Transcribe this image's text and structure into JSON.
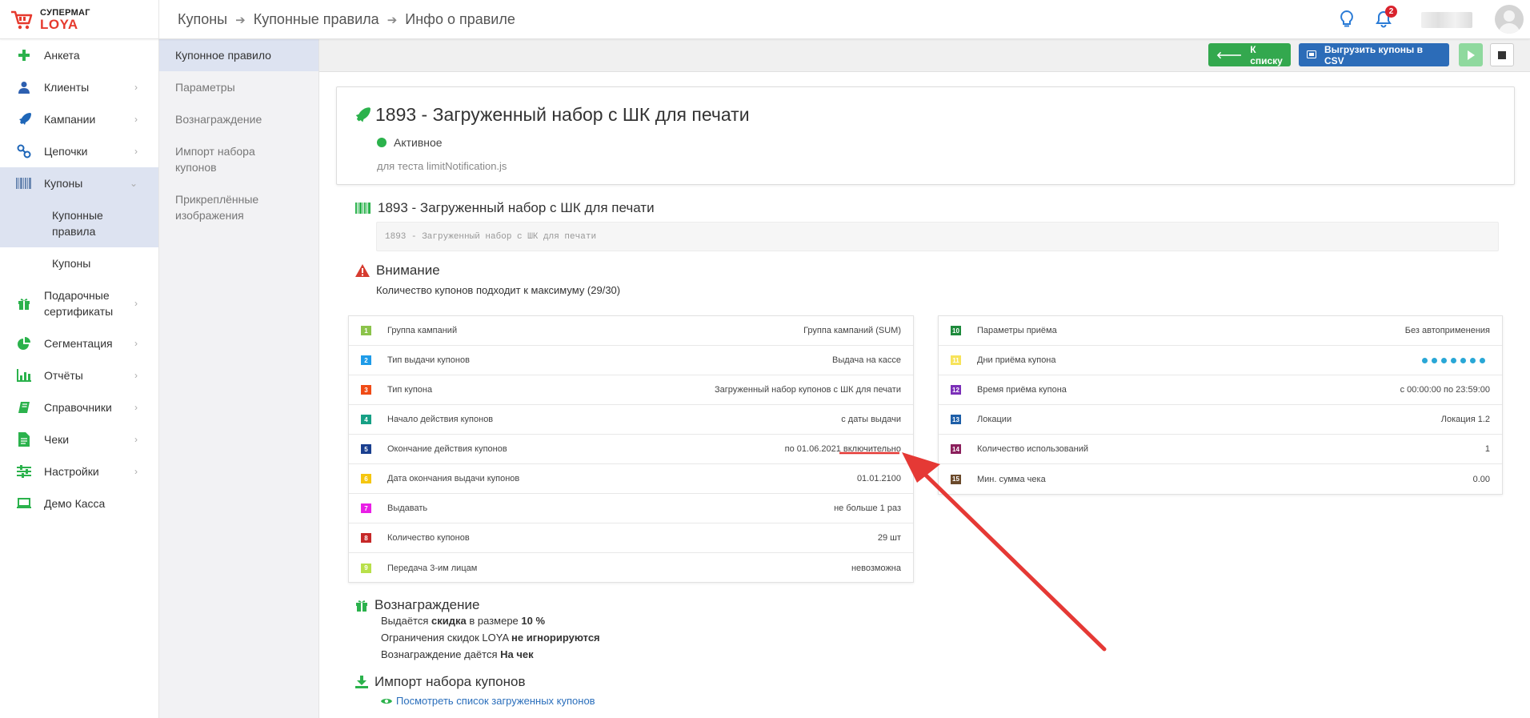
{
  "header": {
    "logo_top": "СУПЕРМАГ",
    "logo_bottom": "LOYA",
    "breadcrumb": [
      "Купоны",
      "Купонные правила",
      "Инфо о правиле"
    ],
    "notifications_count": "2",
    "icons": [
      "lightbulb-icon",
      "bell-icon",
      "user-avatar"
    ]
  },
  "sidebar": {
    "items": [
      {
        "label": "Анкета",
        "icon": "plus-icon",
        "color": "#2bb24c"
      },
      {
        "label": "Клиенты",
        "icon": "user-icon",
        "color": "#2c5fb0"
      },
      {
        "label": "Кампании",
        "icon": "rocket-icon",
        "color": "#1e66b8"
      },
      {
        "label": "Цепочки",
        "icon": "chain-icon",
        "color": "#1e66b8"
      },
      {
        "label": "Купоны",
        "icon": "barcode-icon",
        "color": "#6d8ab3"
      },
      {
        "label": "Подарочные сертификаты",
        "icon": "gift-icon",
        "color": "#2bb24c"
      },
      {
        "label": "Сегментация",
        "icon": "pie-icon",
        "color": "#2bb24c"
      },
      {
        "label": "Отчёты",
        "icon": "bar-chart-icon",
        "color": "#2bb24c"
      },
      {
        "label": "Справочники",
        "icon": "book-icon",
        "color": "#2bb24c"
      },
      {
        "label": "Чеки",
        "icon": "receipt-icon",
        "color": "#2bb24c"
      },
      {
        "label": "Настройки",
        "icon": "sliders-icon",
        "color": "#2bb24c"
      },
      {
        "label": "Демо Касса",
        "icon": "laptop-icon",
        "color": "#2bb24c"
      }
    ],
    "sub_items": [
      "Купонные правила",
      "Купоны"
    ]
  },
  "subnav": {
    "items": [
      "Купонное правило",
      "Параметры",
      "Вознаграждение",
      "Импорт набора купонов",
      "Прикреплённые изображения"
    ]
  },
  "toolbar": {
    "back_label": "К списку",
    "export_label": "Выгрузить купоны в CSV",
    "colors": {
      "green": "#33a84e",
      "blue": "#2c6cb8"
    }
  },
  "rule": {
    "title": "1893 - Загруженный набор с ШК для печати",
    "status": "Активное",
    "description": "для теста limitNotification.js",
    "coupon_name": "1893 - Загруженный набор с ШК для печати",
    "coupon_code": "1893 - Загруженный набор с ШК для печати"
  },
  "warning": {
    "title": "Внимание",
    "text": "Количество купонов подходит к максимуму (29/30)"
  },
  "params_left": [
    {
      "num": "1",
      "color": "#8bc34a",
      "label": "Группа кампаний",
      "value": "Группа кампаний (SUM)"
    },
    {
      "num": "2",
      "color": "#1e9be8",
      "label": "Тип выдачи купонов",
      "value": "Выдача на кассе"
    },
    {
      "num": "3",
      "color": "#f04b16",
      "label": "Тип купона",
      "value": "Загруженный набор купонов с ШК для печати"
    },
    {
      "num": "4",
      "color": "#16a085",
      "label": "Начало действия купонов",
      "value": "с даты выдачи"
    },
    {
      "num": "5",
      "color": "#1a3f8f",
      "label": "Окончание действия купонов",
      "value_prefix": "по 01.06.2021",
      "value_suffix": "включительно"
    },
    {
      "num": "6",
      "color": "#f5c60f",
      "label": "Дата окончания выдачи купонов",
      "value": "01.01.2100"
    },
    {
      "num": "7",
      "color": "#e91ee6",
      "label": "Выдавать",
      "value": "не больше 1 раз"
    },
    {
      "num": "8",
      "color": "#c62828",
      "label": "Количество купонов",
      "value": "29 шт"
    },
    {
      "num": "9",
      "color": "#b8e04a",
      "label": "Передача 3-им лицам",
      "value": "невозможна"
    }
  ],
  "params_right": [
    {
      "num": "10",
      "color": "#1e8a3c",
      "label": "Параметры приёма",
      "value": "Без автоприменения"
    },
    {
      "num": "11",
      "color": "#f7e35a",
      "label": "Дни приёма купона",
      "value": "",
      "day_dots": 7
    },
    {
      "num": "12",
      "color": "#7b2fb8",
      "label": "Время приёма купона",
      "value": "с 00:00:00 по 23:59:00"
    },
    {
      "num": "13",
      "color": "#1e5fa8",
      "label": "Локации",
      "value": "Локация 1.2"
    },
    {
      "num": "14",
      "color": "#8b1f5c",
      "label": "Количество использований",
      "value": "1"
    },
    {
      "num": "15",
      "color": "#6b4a2b",
      "label": "Мин. сумма чека",
      "value": "0.00"
    }
  ],
  "reward": {
    "title": "Вознаграждение",
    "line1_a": "Выдаётся ",
    "line1_b": "скидка",
    "line1_c": " в размере ",
    "line1_d": "10 %",
    "line2_a": "Ограничения скидок LOYA ",
    "line2_b": "не игнорируются",
    "line3_a": "Вознаграждение даётся ",
    "line3_b": "На чек"
  },
  "import": {
    "title": "Импорт набора купонов",
    "link": "Посмотреть список загруженных купонов"
  },
  "annotation": {
    "color": "#e53935",
    "icon": "red-arrow-annotation"
  }
}
